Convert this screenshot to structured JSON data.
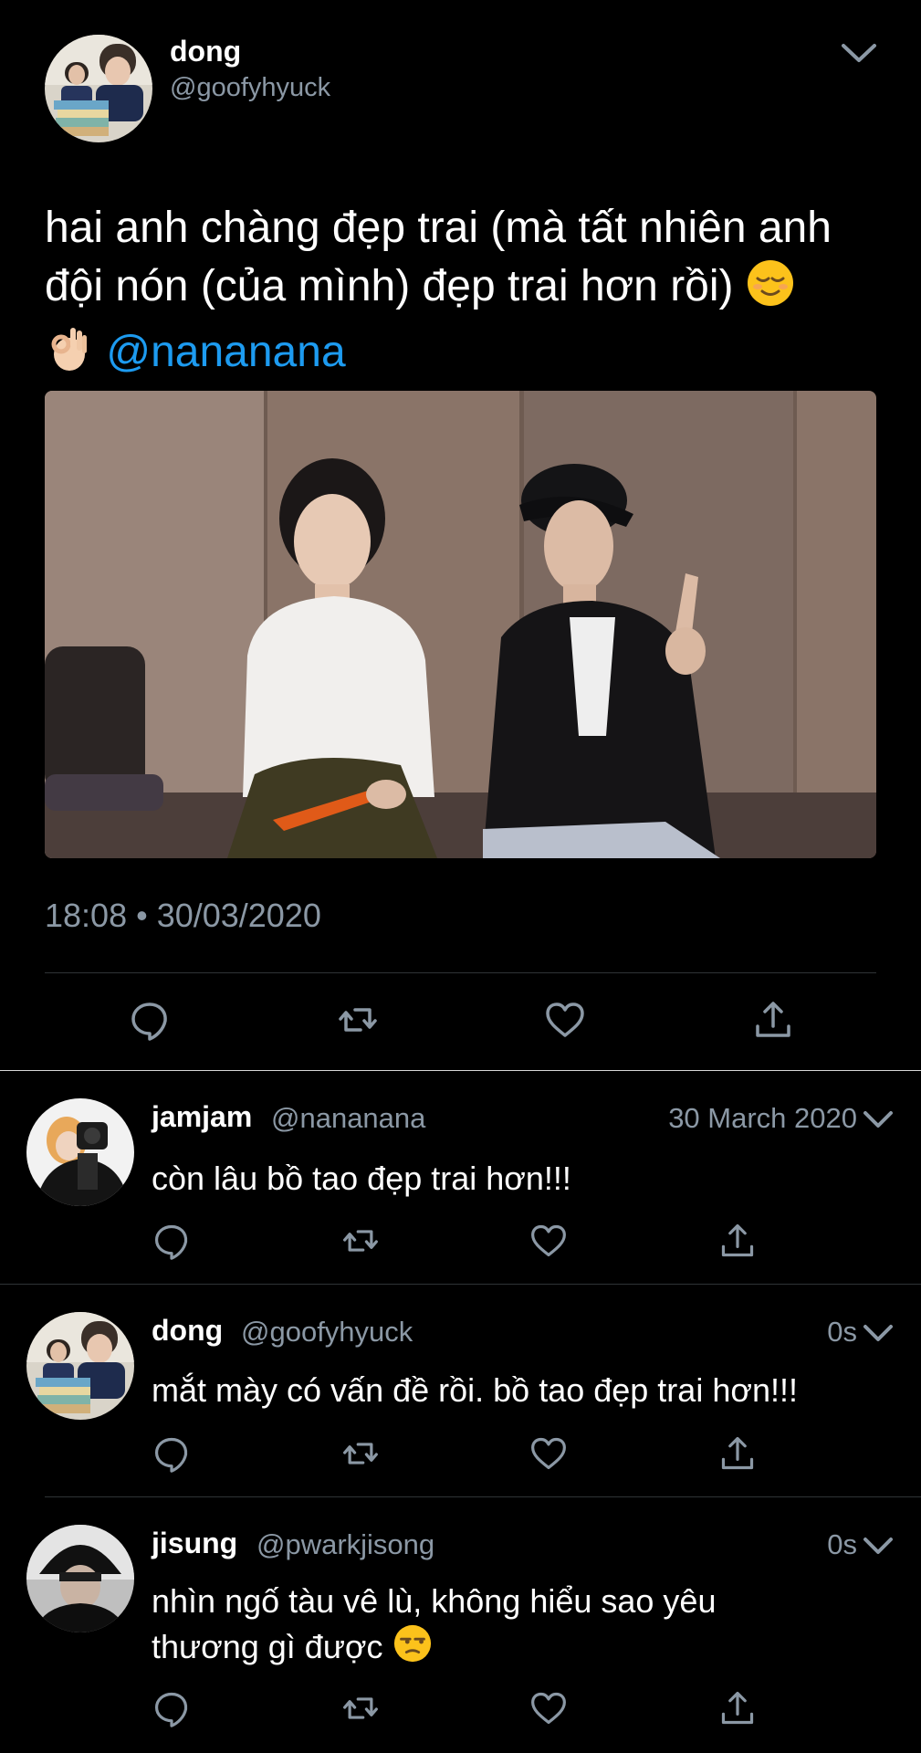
{
  "main_tweet": {
    "author_name": "dong",
    "author_handle": "@goofyhyuck",
    "text_line1": "hai anh chàng đẹp trai (mà tất nhiên anh",
    "text_line2": "đội nón (của mình) đẹp trai hơn rồi)",
    "mention": "@nananana",
    "timestamp": "18:08 • 30/03/2020",
    "icons": [
      "reply-icon",
      "retweet-icon",
      "like-icon",
      "share-icon"
    ]
  },
  "replies": [
    {
      "author_name": "jamjam",
      "author_handle": "@nananana",
      "time": "30 March 2020",
      "text": "còn lâu bồ tao đẹp trai hơn!!!"
    },
    {
      "author_name": "dong",
      "author_handle": "@goofyhyuck",
      "time": "0s",
      "text": "mắt mày có vấn đề rồi. bồ tao đẹp trai hơn!!!"
    },
    {
      "author_name": "jisung",
      "author_handle": "@pwarkjisong",
      "time": "0s",
      "text_line1": "nhìn ngố tàu vê lù, không hiểu sao yêu",
      "text_line2": "thương gì được"
    }
  ],
  "colors": {
    "background": "#000000",
    "text": "#ffffff",
    "secondary": "#8b98a5",
    "link": "#1d9bf0",
    "divider": "#2f3336"
  }
}
